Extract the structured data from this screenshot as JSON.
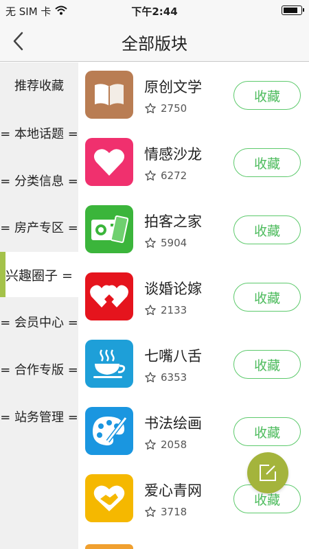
{
  "status": {
    "carrier": "无 SIM 卡",
    "time": "下午2:44",
    "battery_level": 0.85
  },
  "header": {
    "title": "全部版块"
  },
  "sidebar": {
    "items": [
      {
        "label": "推荐收藏",
        "active": false
      },
      {
        "label": "= 本地话题 =",
        "active": false
      },
      {
        "label": "= 分类信息 =",
        "active": false
      },
      {
        "label": "= 房产专区 =",
        "active": false
      },
      {
        "label": "兴趣圈子 =",
        "active": true
      },
      {
        "label": "= 会员中心 =",
        "active": false
      },
      {
        "label": "= 合作专版 =",
        "active": false
      },
      {
        "label": "= 站务管理 =",
        "active": false
      }
    ]
  },
  "forums": {
    "fav_label": "收藏",
    "items": [
      {
        "name": "原创文学",
        "count": "2750",
        "icon": "book-icon",
        "color": "#b97d53"
      },
      {
        "name": "情感沙龙",
        "count": "6272",
        "icon": "heart-icon",
        "color": "#f0306e"
      },
      {
        "name": "拍客之家",
        "count": "5904",
        "icon": "camera-icon",
        "color": "#3bb53b"
      },
      {
        "name": "谈婚论嫁",
        "count": "2133",
        "icon": "double-heart-icon",
        "color": "#e5141d"
      },
      {
        "name": "七嘴八舌",
        "count": "6353",
        "icon": "coffee-cup-icon",
        "color": "#1e9fd8"
      },
      {
        "name": "书法绘画",
        "count": "2058",
        "icon": "palette-icon",
        "color": "#1a96e0"
      },
      {
        "name": "爱心青网",
        "count": "3718",
        "icon": "handshake-heart-icon",
        "color": "#f5b800"
      }
    ]
  },
  "colors": {
    "accent": "#a4c24a",
    "button": "#4cbb5c",
    "fab": "#a4b43c"
  }
}
